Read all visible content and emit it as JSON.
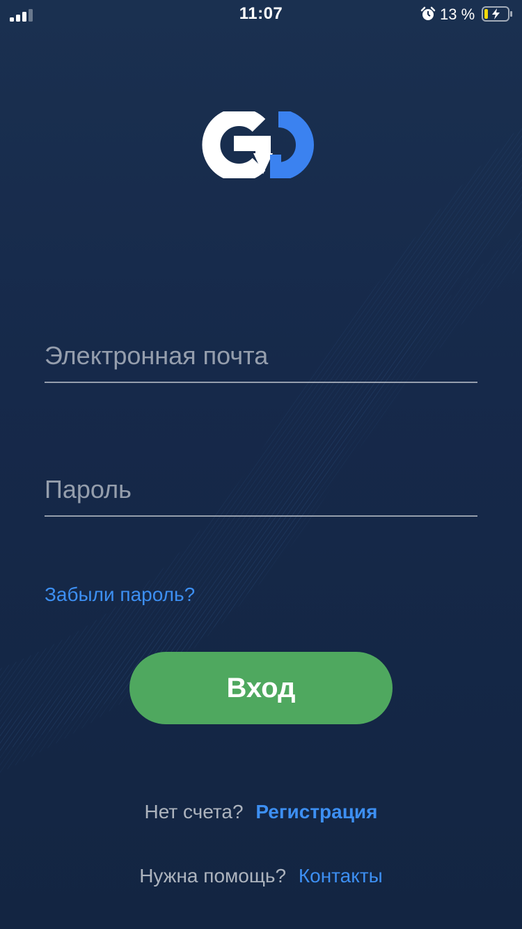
{
  "status_bar": {
    "time": "11:07",
    "battery_percent": "13 %",
    "signal_icon": "signal-icon",
    "alarm_icon": "alarm-icon",
    "battery_icon": "battery-charging-icon"
  },
  "logo": {
    "text": "GO",
    "colors": {
      "g": "#ffffff",
      "o": "#3b82f0"
    }
  },
  "form": {
    "email": {
      "value": "",
      "placeholder": "Электронная почта"
    },
    "password": {
      "value": "",
      "placeholder": "Пароль"
    },
    "forgot_label": "Забыли пароль?",
    "login_label": "Вход"
  },
  "footer": {
    "no_account_text": "Нет счета?",
    "register_label": "Регистрация",
    "help_text": "Нужна помощь?",
    "contacts_label": "Контакты"
  },
  "colors": {
    "background": "#16294a",
    "accent_link": "#3d8ff2",
    "button": "#4fa85f"
  }
}
